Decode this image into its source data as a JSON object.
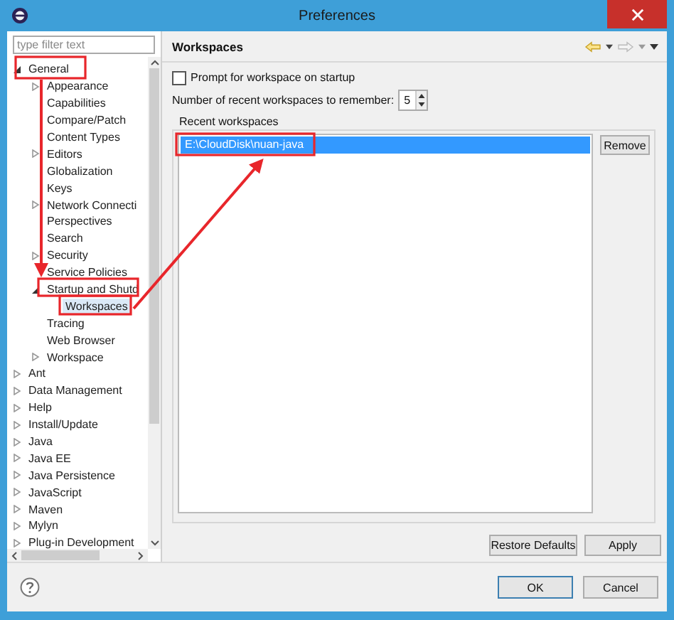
{
  "window": {
    "title": "Preferences"
  },
  "filter": {
    "placeholder": "type filter text"
  },
  "tree": [
    {
      "label": "General",
      "expanded": true,
      "selected": false,
      "children": [
        {
          "label": "Appearance",
          "expanded": false,
          "selected": false
        },
        {
          "label": "Capabilities",
          "selected": false
        },
        {
          "label": "Compare/Patch",
          "selected": false
        },
        {
          "label": "Content Types",
          "selected": false
        },
        {
          "label": "Editors",
          "expanded": false,
          "selected": false
        },
        {
          "label": "Globalization",
          "selected": false
        },
        {
          "label": "Keys",
          "selected": false
        },
        {
          "label": "Network Connecti",
          "expanded": false,
          "selected": false
        },
        {
          "label": "Perspectives",
          "selected": false
        },
        {
          "label": "Search",
          "selected": false
        },
        {
          "label": "Security",
          "expanded": false,
          "selected": false
        },
        {
          "label": "Service Policies",
          "selected": false
        },
        {
          "label": "Startup and Shutd",
          "expanded": true,
          "selected": false,
          "children": [
            {
              "label": "Workspaces",
              "selected": true
            }
          ]
        },
        {
          "label": "Tracing",
          "selected": false
        },
        {
          "label": "Web Browser",
          "selected": false
        },
        {
          "label": "Workspace",
          "expanded": false,
          "selected": false
        }
      ]
    },
    {
      "label": "Ant",
      "expanded": false,
      "selected": false
    },
    {
      "label": "Data Management",
      "expanded": false,
      "selected": false
    },
    {
      "label": "Help",
      "expanded": false,
      "selected": false
    },
    {
      "label": "Install/Update",
      "expanded": false,
      "selected": false
    },
    {
      "label": "Java",
      "expanded": false,
      "selected": false
    },
    {
      "label": "Java EE",
      "expanded": false,
      "selected": false
    },
    {
      "label": "Java Persistence",
      "expanded": false,
      "selected": false
    },
    {
      "label": "JavaScript",
      "expanded": false,
      "selected": false
    },
    {
      "label": "Maven",
      "expanded": false,
      "selected": false
    },
    {
      "label": "Mylyn",
      "expanded": false,
      "selected": false
    },
    {
      "label": "Plug-in Development",
      "expanded": false,
      "selected": false
    }
  ],
  "page": {
    "title": "Workspaces",
    "prompt_checkbox": {
      "label": "Prompt for workspace on startup",
      "checked": false
    },
    "recent_count": {
      "label": "Number of recent workspaces to remember:",
      "value": "5"
    },
    "recent_group": {
      "label": "Recent workspaces",
      "items": [
        {
          "label": "E:\\CloudDisk\\nuan-java",
          "selected": true
        }
      ],
      "remove_button": "Remove"
    },
    "buttons": [
      "Restore Defaults",
      "Apply"
    ]
  },
  "dialog_buttons": [
    "OK",
    "Cancel"
  ]
}
